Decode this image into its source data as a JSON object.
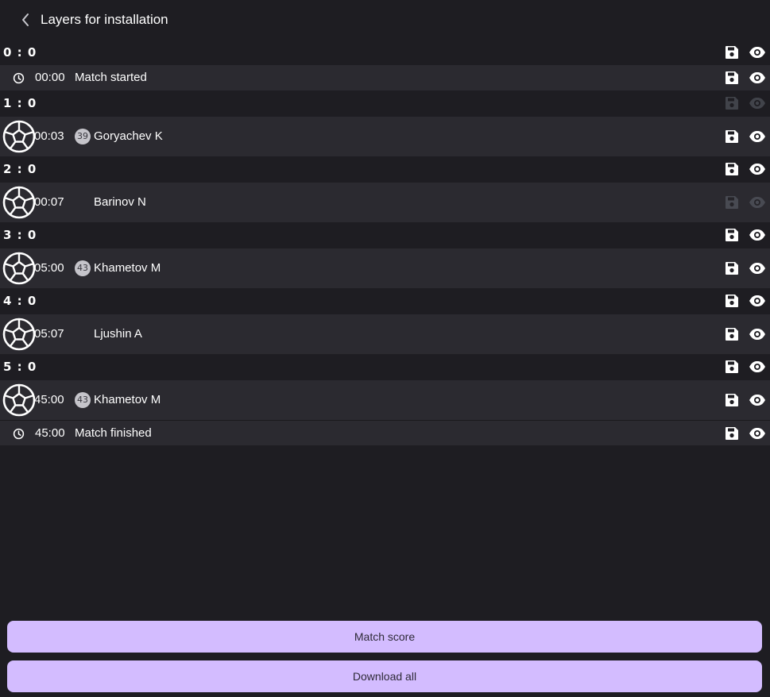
{
  "header": {
    "title": "Layers for installation",
    "back_icon": "chevron-left-icon"
  },
  "colors": {
    "background": "#1e1d22",
    "row_background": "#2b2a30",
    "button_background": "#d3bcff",
    "button_text": "#2e2a38",
    "icon_active": "#ffffff",
    "icon_dimmed": "#6d727c"
  },
  "rows": [
    {
      "type": "score",
      "score": "0 : 0",
      "dimmed": false
    },
    {
      "type": "event",
      "time": "00:00",
      "text": "Match started",
      "dimmed": false
    },
    {
      "type": "score",
      "score": "1 : 0",
      "dimmed": true
    },
    {
      "type": "goal",
      "time": "00:03",
      "number": "39",
      "player": "Goryachev K",
      "dimmed": false
    },
    {
      "type": "score",
      "score": "2 : 0",
      "dimmed": false
    },
    {
      "type": "goal",
      "time": "00:07",
      "number": "",
      "player": "Barinov N",
      "dimmed": true
    },
    {
      "type": "score",
      "score": "3 : 0",
      "dimmed": false
    },
    {
      "type": "goal",
      "time": "05:00",
      "number": "43",
      "player": "Khametov M",
      "dimmed": false
    },
    {
      "type": "score",
      "score": "4 : 0",
      "dimmed": false
    },
    {
      "type": "goal",
      "time": "05:07",
      "number": "",
      "player": "Ljushin A",
      "dimmed": false
    },
    {
      "type": "score",
      "score": "5 : 0",
      "dimmed": false
    },
    {
      "type": "goal",
      "time": "45:00",
      "number": "43",
      "player": "Khametov M",
      "dimmed": false
    },
    {
      "type": "event",
      "time": "45:00",
      "text": "Match finished",
      "dimmed": false
    }
  ],
  "actions": {
    "match_score_label": "Match score",
    "download_all_label": "Download all"
  }
}
